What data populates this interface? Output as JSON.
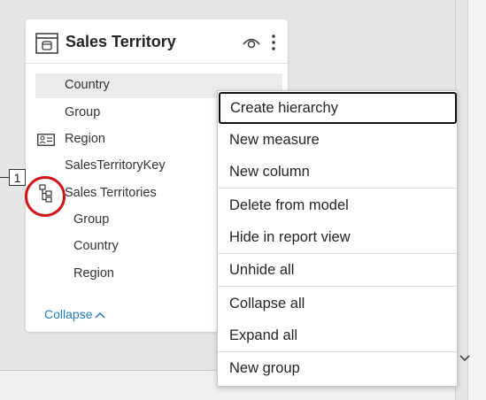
{
  "table_card": {
    "title": "Sales Territory",
    "icons": {
      "header": "table-icon",
      "visibility": "eye-icon",
      "more": "more-options-icon"
    },
    "fields": [
      {
        "label": "Country",
        "selected": true
      },
      {
        "label": "Group"
      },
      {
        "label": "Region",
        "icon": "region-field-icon"
      },
      {
        "label": "SalesTerritoryKey"
      },
      {
        "label": "Sales Territories",
        "icon": "hierarchy-icon"
      },
      {
        "label": "Group",
        "hierarchy_level": true
      },
      {
        "label": "Country",
        "hierarchy_level": true
      },
      {
        "label": "Region",
        "hierarchy_level": true
      }
    ],
    "collapse_label": "Collapse"
  },
  "annotation": {
    "number": "1",
    "highlight_color": "#d0141c"
  },
  "context_menu": {
    "items": [
      {
        "label": "Create hierarchy",
        "focused": true
      },
      {
        "label": "New measure"
      },
      {
        "label": "New column"
      },
      {
        "label": "Delete from model"
      },
      {
        "label": "Hide in report view"
      },
      {
        "label": "Unhide all"
      },
      {
        "label": "Collapse all"
      },
      {
        "label": "Expand all"
      },
      {
        "label": "New group"
      }
    ]
  },
  "colors": {
    "link": "#1f7ab8",
    "canvas": "#e6e6e6",
    "selected_row": "#ebebeb"
  }
}
